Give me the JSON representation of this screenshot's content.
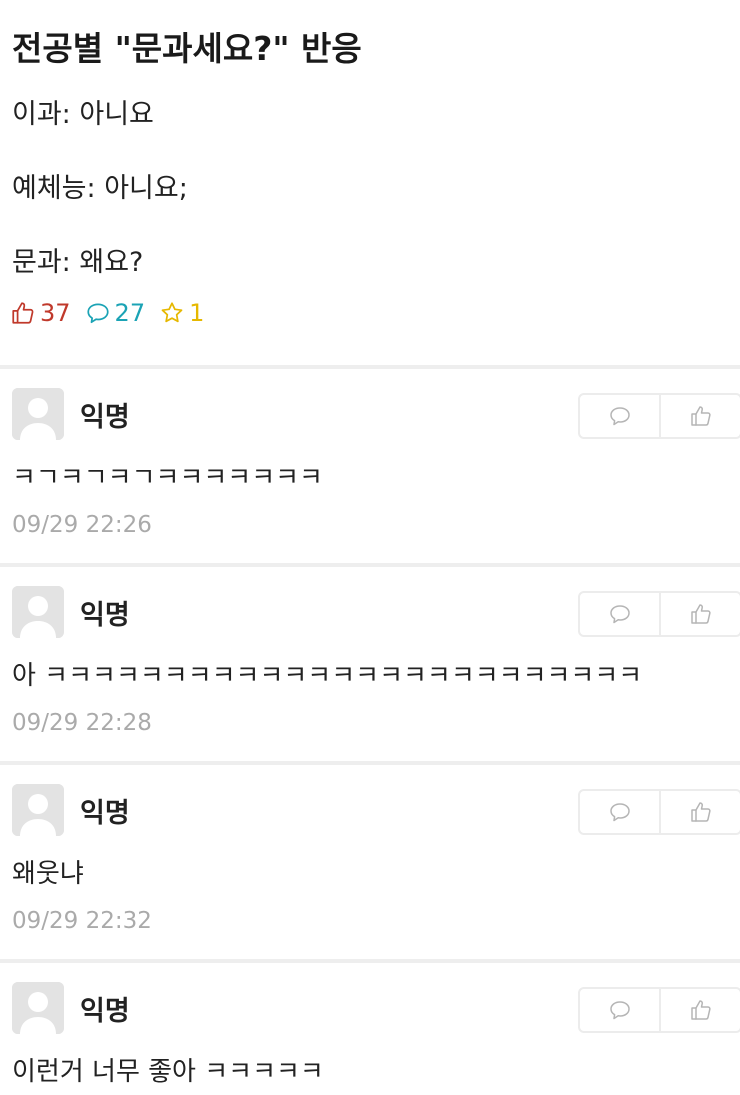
{
  "post": {
    "title": "전공별 \"문과세요?\" 반응",
    "lines": [
      "이과: 아니요",
      "예체능: 아니요;",
      "문과: 왜요?"
    ],
    "stats": {
      "likes": "37",
      "comments": "27",
      "scraps": "1"
    }
  },
  "comments": [
    {
      "author": "익명",
      "text": "ㅋㄱㅋㄱㅋㄱㅋㅋㅋㅋㅋㅋㅋ",
      "time": "09/29 22:26"
    },
    {
      "author": "익명",
      "text": "아 ㅋㅋㅋㅋㅋㅋㅋㅋㅋㅋㅋㅋㅋㅋㅋㅋㅋㅋㅋㅋㅋㅋㅋㅋㅋ",
      "time": "09/29 22:28"
    },
    {
      "author": "익명",
      "text": "왜웃냐",
      "time": "09/29 22:32"
    },
    {
      "author": "익명",
      "text": "이런거 너무 좋아 ㅋㅋㅋㅋㅋ",
      "time": ""
    }
  ],
  "colors": {
    "like": "#c0392b",
    "comment": "#1ba3b5",
    "scrap": "#e6b800",
    "timestamp": "#aaaaaa",
    "divider": "#eeeeee"
  },
  "icons": {
    "like": "thumbs-up-icon",
    "comment": "speech-bubble-icon",
    "scrap": "star-icon",
    "avatar": "default-avatar-icon"
  }
}
